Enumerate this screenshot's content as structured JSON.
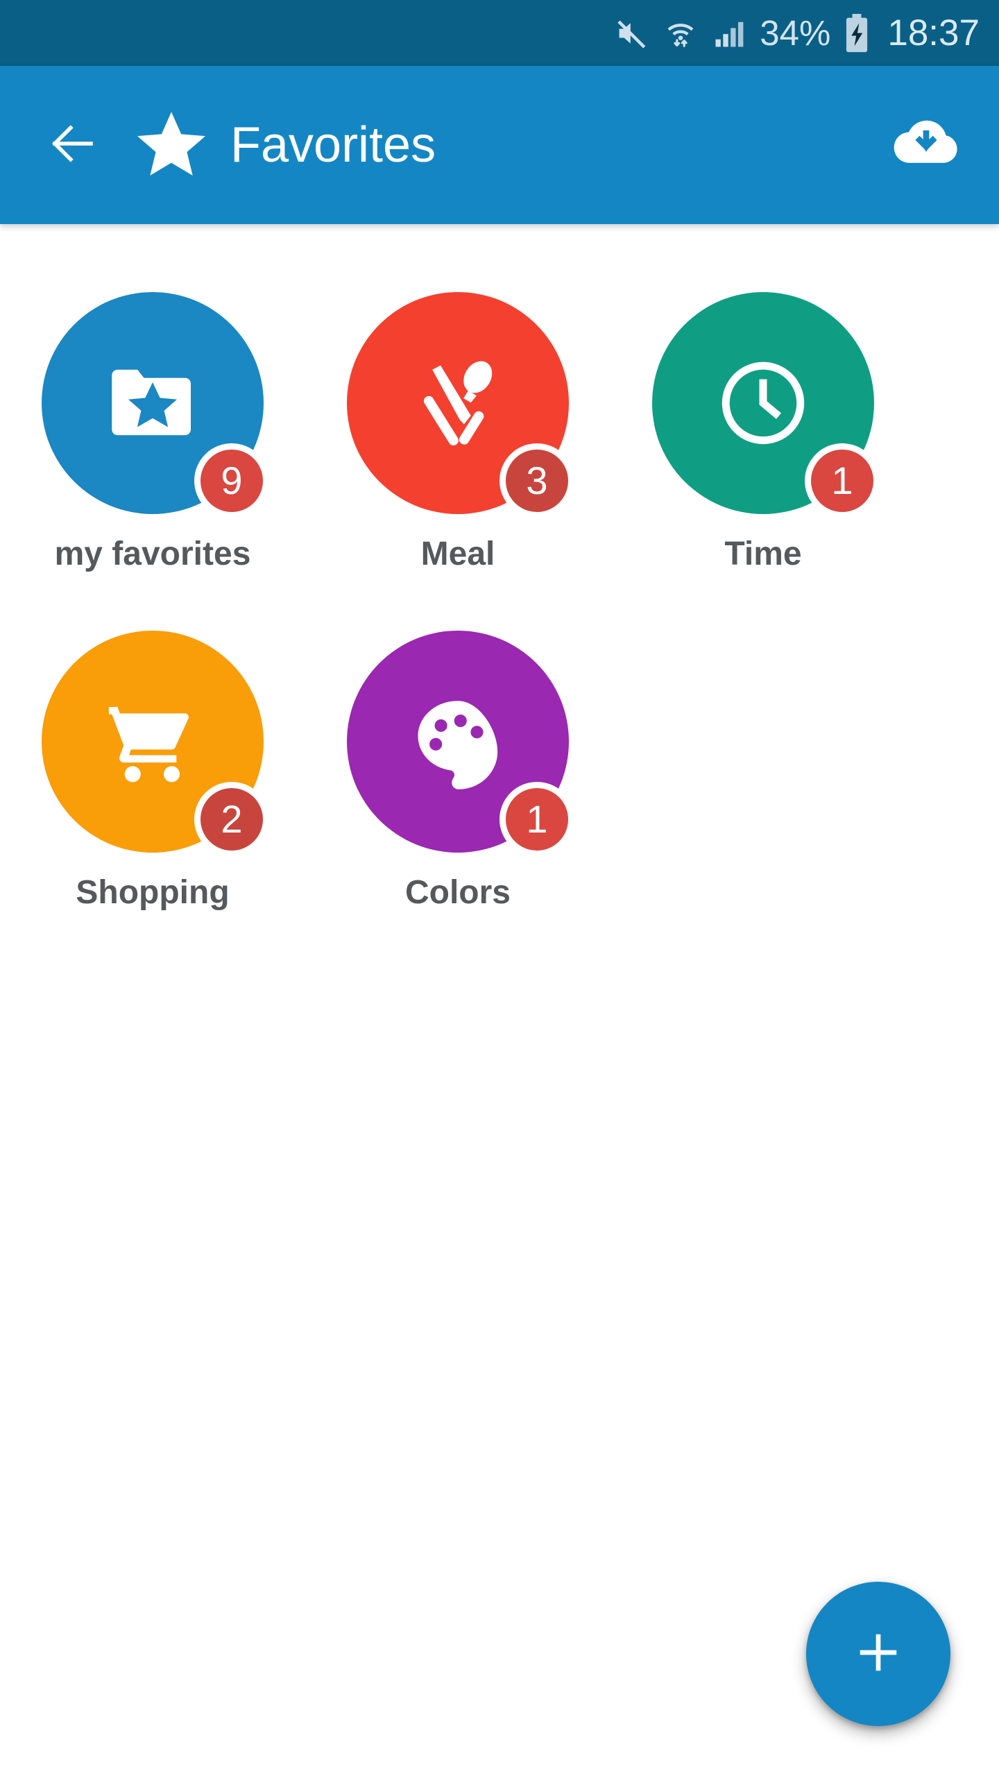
{
  "status_bar": {
    "background": "#0a5f87",
    "mute_icon": "mute-icon",
    "wifi_icon": "wifi-transfer-icon",
    "signal_icon": "cellular-signal-icon",
    "battery_percent": "34%",
    "battery_icon": "battery-charging-icon",
    "time": "18:37"
  },
  "app_bar": {
    "background": "#1586c4",
    "back_icon": "back-arrow-icon",
    "star_icon": "star-icon",
    "title": "Favorites",
    "download_icon": "cloud-download-icon"
  },
  "categories": [
    {
      "label": "my favorites",
      "badge": "9",
      "color": "#1b87c3",
      "badge_color": "#d94740",
      "icon": "folder-star-icon"
    },
    {
      "label": "Meal",
      "badge": "3",
      "color": "#f4402f",
      "badge_color": "#c8453d",
      "icon": "knife-spoon-icon"
    },
    {
      "label": "Time",
      "badge": "1",
      "color": "#0f9e84",
      "badge_color": "#d94740",
      "icon": "clock-icon"
    },
    {
      "label": "Shopping",
      "badge": "2",
      "color": "#f99d09",
      "badge_color": "#c8453d",
      "icon": "shopping-cart-icon"
    },
    {
      "label": "Colors",
      "badge": "1",
      "color": "#9a28b0",
      "badge_color": "#d94740",
      "icon": "paint-palette-icon"
    }
  ],
  "fab": {
    "label": "+",
    "icon": "plus-icon",
    "color": "#1586c4"
  }
}
